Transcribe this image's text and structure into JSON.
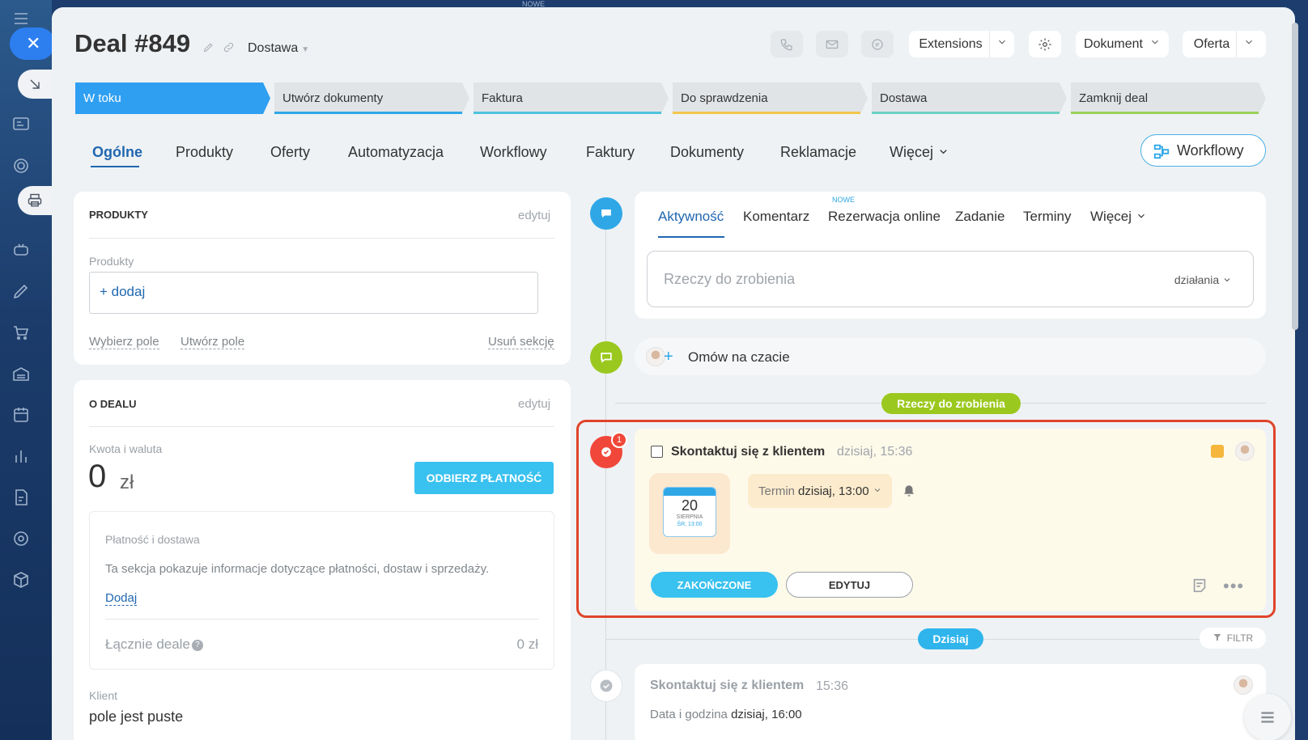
{
  "top_new": "NOWE",
  "header": {
    "title": "Deal #849",
    "pipeline": "Dostawa",
    "extensions": "Extensions",
    "dokument": "Dokument",
    "oferta": "Oferta"
  },
  "stages": [
    {
      "label": "W toku",
      "color": "#2f9ff2"
    },
    {
      "label": "Utwórz dokumenty",
      "color": "#2fa7e7"
    },
    {
      "label": "Faktura",
      "color": "#4ec3dc"
    },
    {
      "label": "Do sprawdzenia",
      "color": "#f3c64c"
    },
    {
      "label": "Dostawa",
      "color": "#6cd1c4"
    },
    {
      "label": "Zamknij deal",
      "color": "#9bd15a"
    }
  ],
  "tabs": [
    "Ogólne",
    "Produkty",
    "Oferty",
    "Automatyzacja",
    "Workflowy",
    "Faktury",
    "Dokumenty",
    "Reklamacje",
    "Więcej"
  ],
  "workflow_button": "Workflowy",
  "produkty": {
    "title": "PRODUKTY",
    "edit": "edytuj",
    "field_label": "Produkty",
    "add": "+ dodaj",
    "select_field": "Wybierz pole",
    "create_field": "Utwórz pole",
    "delete_section": "Usuń sekcję"
  },
  "o_dealu": {
    "title": "O DEALU",
    "edit": "edytuj",
    "amount_label": "Kwota i waluta",
    "amount": "0",
    "currency": "zł",
    "pay_button": "ODBIERZ PŁATNOŚĆ",
    "payment_title": "Płatność i dostawa",
    "payment_desc": "Ta sekcja pokazuje informacje dotyczące płatności, dostaw i sprzedaży.",
    "add_link": "Dodaj",
    "total_label": "Łącznie deale",
    "total_value": "0 zł",
    "client_label": "Klient",
    "client_value": "pole jest puste"
  },
  "activity": {
    "tabs": [
      "Aktywność",
      "Komentarz",
      "Rezerwacja online",
      "Zadanie",
      "Terminy",
      "Więcej"
    ],
    "new_badge": "NOWE",
    "input_placeholder": "Rzeczy do zrobienia",
    "actions": "działania"
  },
  "chat": {
    "label": "Omów na czacie"
  },
  "todo_pill": "Rzeczy do zrobienia",
  "task": {
    "badge_count": "1",
    "title": "Skontaktuj się z klientem",
    "time": "dzisiaj, 15:36",
    "cal_day": "20",
    "cal_month": "SIERPNIA",
    "cal_sub": "ŚR, 13:00",
    "deadline_label": "Termin",
    "deadline_value": "dzisiaj, 13:00",
    "done_button": "ZAKOŃCZONE",
    "edit_button": "EDYTUJ"
  },
  "today_pill": "Dzisiaj",
  "filter": "FILTR",
  "done_task": {
    "title": "Skontaktuj się z klientem",
    "time": "15:36",
    "date_label": "Data i godzina",
    "date_value": "dzisiaj, 16:00"
  },
  "colors": {
    "accent": "#2f9ff2",
    "primary_button": "#39c1ef",
    "green_pill": "#9bc81e",
    "highlight": "#e0442a"
  }
}
